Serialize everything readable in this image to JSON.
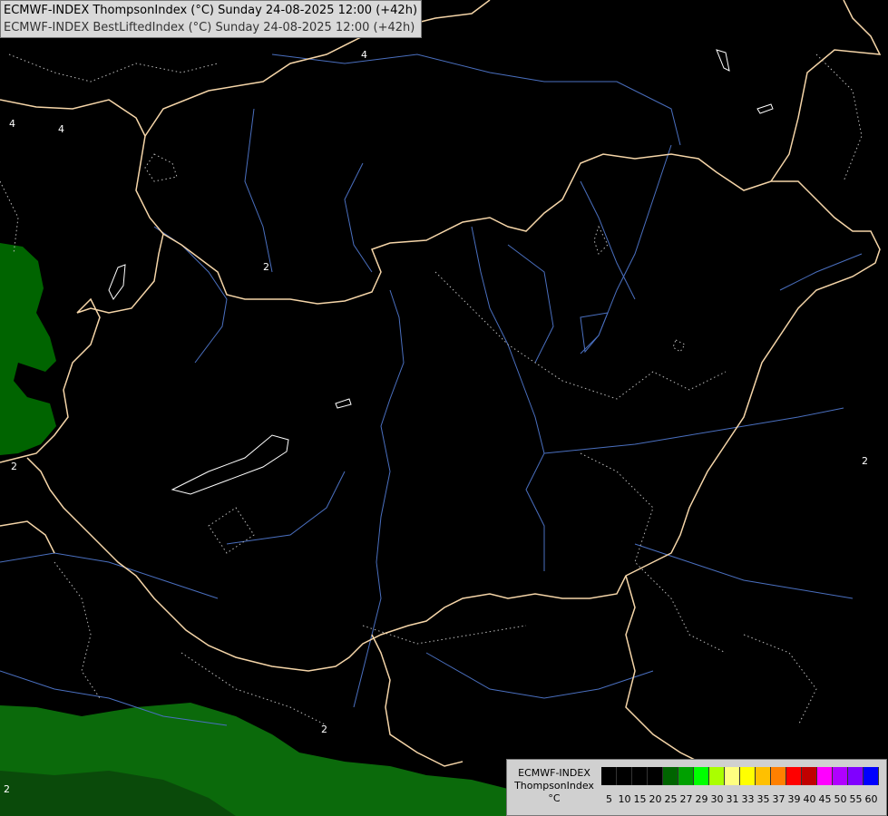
{
  "header": {
    "line1": "ECMWF-INDEX ThompsonIndex (°C) Sunday 24-08-2025 12:00 (+42h)",
    "line2": "ECMWF-INDEX BestLiftedIndex (°C) Sunday 24-08-2025 12:00 (+42h)"
  },
  "legend": {
    "model": "ECMWF-INDEX",
    "parameter": "ThompsonIndex",
    "unit": "°C",
    "colors": [
      "#000000",
      "#000000",
      "#000000",
      "#000000",
      "#006400",
      "#00a000",
      "#00ff00",
      "#aaff00",
      "#ffff80",
      "#ffff00",
      "#ffc000",
      "#ff8000",
      "#ff0000",
      "#c00000",
      "#ff00ff",
      "#b000ff",
      "#8000ff",
      "#0000ff"
    ],
    "ticks": [
      "5",
      "10",
      "15",
      "20",
      "25",
      "27",
      "29",
      "30",
      "31",
      "33",
      "35",
      "37",
      "39",
      "40",
      "45",
      "50",
      "55",
      "60"
    ]
  },
  "map": {
    "contour_labels": [
      "2",
      "2",
      "2",
      "2",
      "4",
      "4",
      "4",
      "2"
    ],
    "colors": {
      "background": "#000000",
      "border": "#f5d5a8",
      "river": "#4a6fbf",
      "contour": "#cccccc",
      "fill_green": "#006400",
      "fill_green_dark": "#0a5a0a"
    }
  }
}
